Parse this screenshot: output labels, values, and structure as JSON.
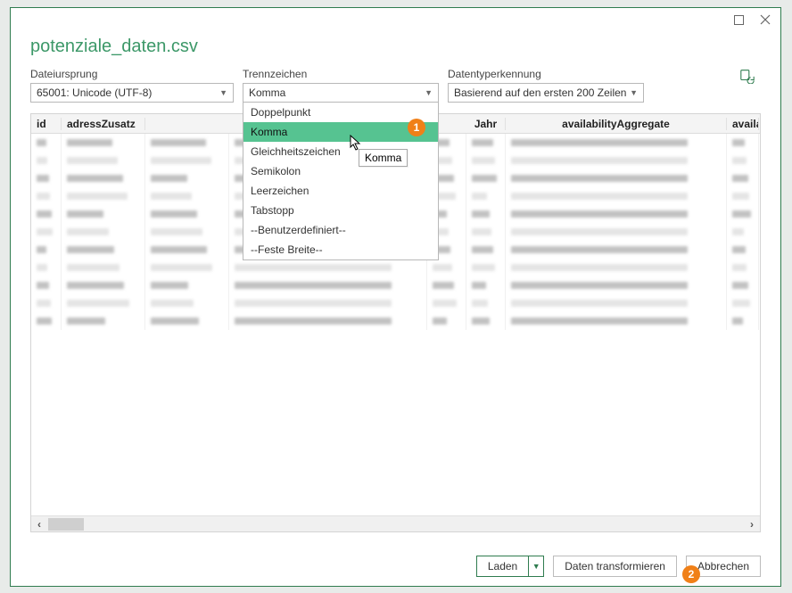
{
  "window": {
    "title": "potenziale_daten.csv"
  },
  "controls": {
    "origin": {
      "label": "Dateiursprung",
      "value": "65001: Unicode (UTF-8)"
    },
    "delim": {
      "label": "Trennzeichen",
      "value": "Komma"
    },
    "dtype": {
      "label": "Datentyperkennung",
      "value": "Basierend auf den ersten 200 Zeilen"
    }
  },
  "delimiter_options": [
    "Doppelpunkt",
    "Komma",
    "Gleichheitszeichen",
    "Semikolon",
    "Leerzeichen",
    "Tabstopp",
    "--Benutzerdefiniert--",
    "--Feste Breite--"
  ],
  "delimiter_selected_index": 1,
  "tooltip": "Komma",
  "grid": {
    "columns": [
      "id",
      "adressZusatz",
      "",
      "",
      "",
      "Jahr",
      "availabilityAggregate",
      "availal"
    ]
  },
  "footer": {
    "load": "Laden",
    "transform": "Daten transformieren",
    "cancel": "Abbrechen"
  },
  "callouts": {
    "one": "1",
    "two": "2"
  }
}
